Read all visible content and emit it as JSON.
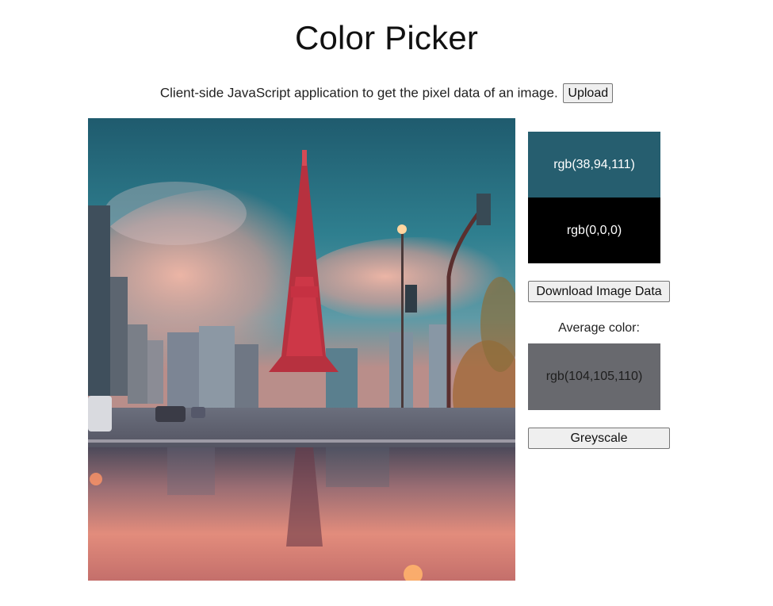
{
  "page": {
    "title": "Color Picker",
    "description": "Client-side JavaScript application to get the pixel data of an image.",
    "upload_label": "Upload"
  },
  "image": {
    "description_icon": "photo-tokyo-tower"
  },
  "swatches": {
    "picked_primary": {
      "label": "rgb(38,94,111)",
      "color": "#265e6f"
    },
    "picked_secondary": {
      "label": "rgb(0,0,0)",
      "color": "#000000"
    }
  },
  "actions": {
    "download_label": "Download Image Data",
    "greyscale_label": "Greyscale"
  },
  "average": {
    "heading": "Average color:",
    "label": "rgb(104,105,110)",
    "color": "#68696e"
  }
}
